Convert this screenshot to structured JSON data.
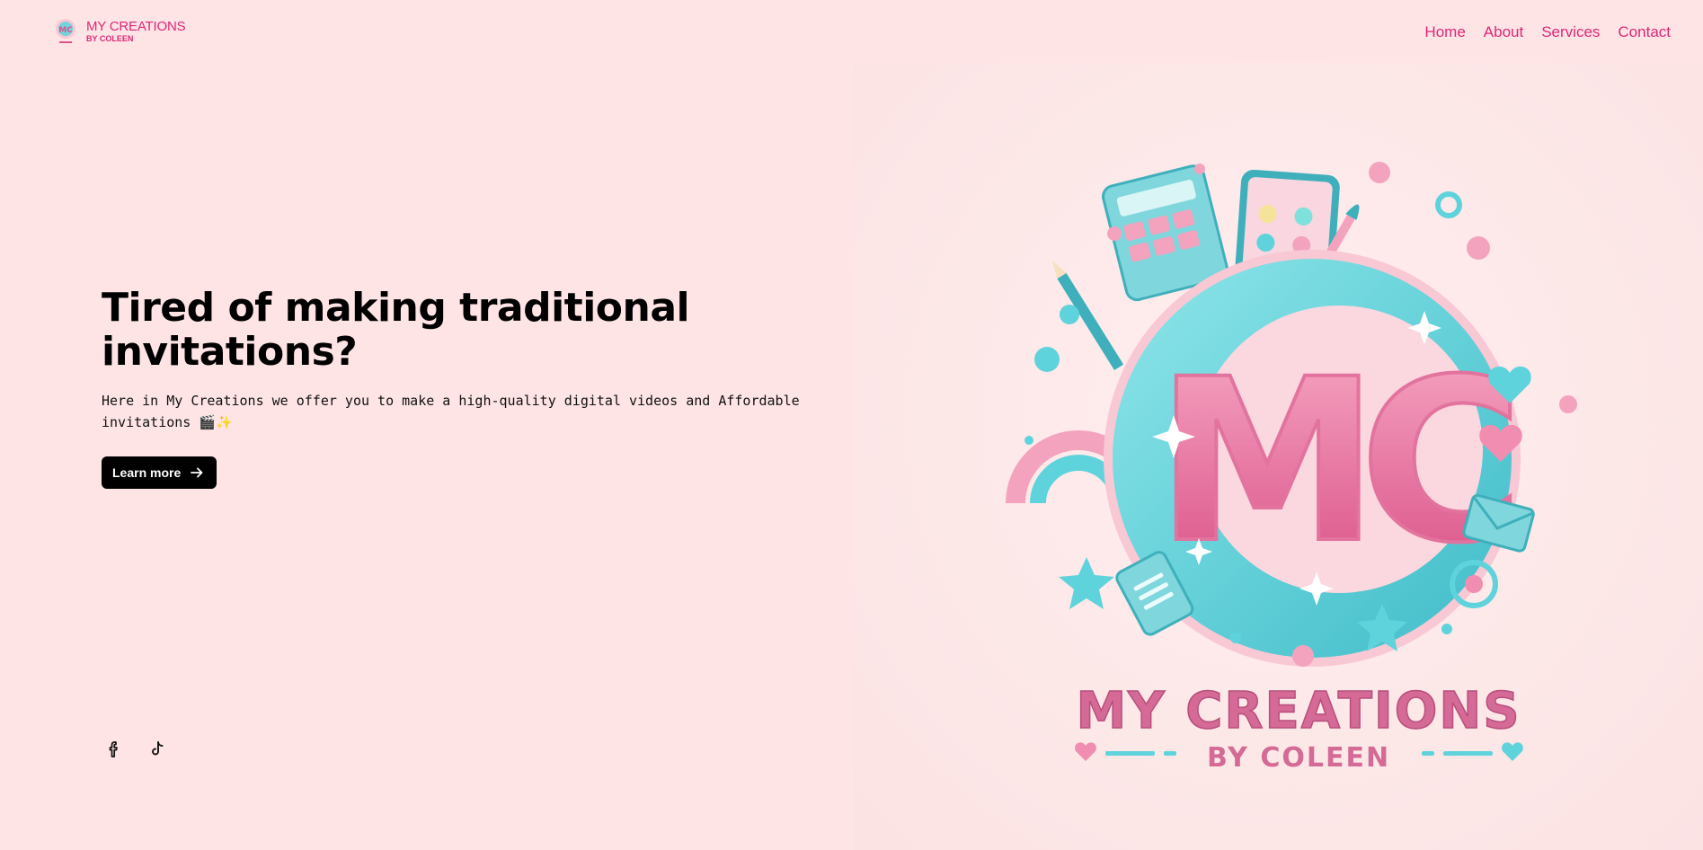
{
  "header": {
    "brand_title": "MY CREATIONS",
    "brand_subtitle": "BY COLEEN",
    "nav": [
      "Home",
      "About",
      "Services",
      "Contact"
    ]
  },
  "hero": {
    "heading_line1": "Tired of making traditional",
    "heading_line2": "invitations?",
    "description": "Here in My Creations we offer you to make a high-quality digital videos and Affordable invitations",
    "emojis": "🎬✨",
    "cta_label": "Learn more"
  },
  "artwork": {
    "monogram": "MC",
    "title": "MY CREATIONS",
    "subtitle": "BY COLEEN"
  },
  "socials": [
    "facebook-icon",
    "tiktok-icon"
  ],
  "colors": {
    "background": "#ffe4e6",
    "accent": "#db2777",
    "button": "#000000",
    "teal": "#5fd3dc",
    "pink": "#f08db0"
  }
}
